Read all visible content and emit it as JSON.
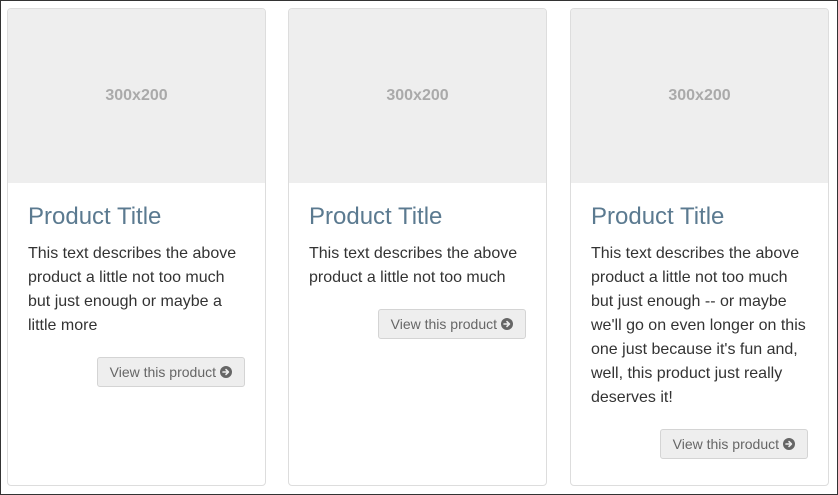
{
  "cards": [
    {
      "image_label": "300x200",
      "title": "Product Title",
      "description": "This text describes the above product a little not too much but just enough or maybe a little more",
      "button_label": "View this product",
      "button_icon": "arrow-circle-right-icon"
    },
    {
      "image_label": "300x200",
      "title": "Product Title",
      "description": "This text describes the above product a little not too much",
      "button_label": "View this product",
      "button_icon": "arrow-circle-right-icon"
    },
    {
      "image_label": "300x200",
      "title": "Product Title",
      "description": "This text describes the above product a little not too much but just enough -- or maybe we'll go on even longer on this one just because it's fun and, well, this product just really deserves it!",
      "button_label": "View this product",
      "button_icon": "arrow-circle-right-icon"
    }
  ],
  "colors": {
    "title": "#5b7a90",
    "text": "#333333",
    "placeholder_bg": "#eeeeee",
    "placeholder_text": "#aaaaaa",
    "button_bg": "#eeeeee"
  }
}
